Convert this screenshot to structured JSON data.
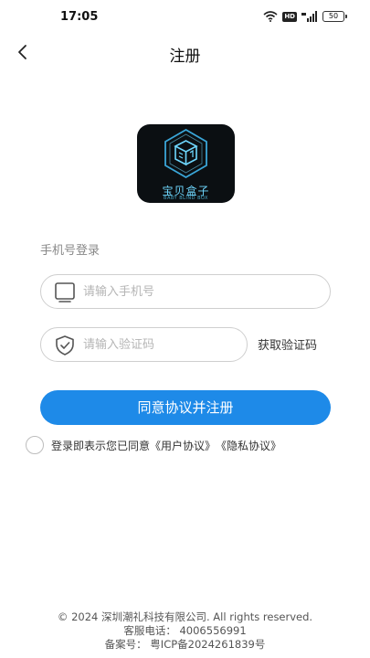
{
  "status_bar": {
    "time": "17:05",
    "hd": "HD",
    "battery": "50",
    "icons": [
      "wifi-icon",
      "hd-icon",
      "signal-icon",
      "battery-icon"
    ]
  },
  "nav": {
    "title": "注册",
    "back_icon": "chevron-left-icon"
  },
  "logo": {
    "title": "宝贝盒子",
    "subtitle": "BABY BLIND BOX",
    "accent": "#6fd8ff"
  },
  "form": {
    "section_label": "手机号登录",
    "phone_placeholder": "请输入手机号",
    "code_placeholder": "请输入验证码",
    "get_code_label": "获取验证码",
    "submit_label": "同意协议并注册"
  },
  "agreement": {
    "prefix": "登录即表示您已同意",
    "user_agreement": "《用户协议》",
    "privacy_agreement": "《隐私协议》"
  },
  "footer": {
    "copyright": "© 2024 深圳潮礼科技有限公司. All rights reserved.",
    "service_phone": "客服电话： 4006556991",
    "icp": "备案号： 粤ICP备2024261839号"
  },
  "colors": {
    "primary": "#1e8ae8",
    "border": "#cfcfcf",
    "placeholder": "#b5b5b5"
  }
}
